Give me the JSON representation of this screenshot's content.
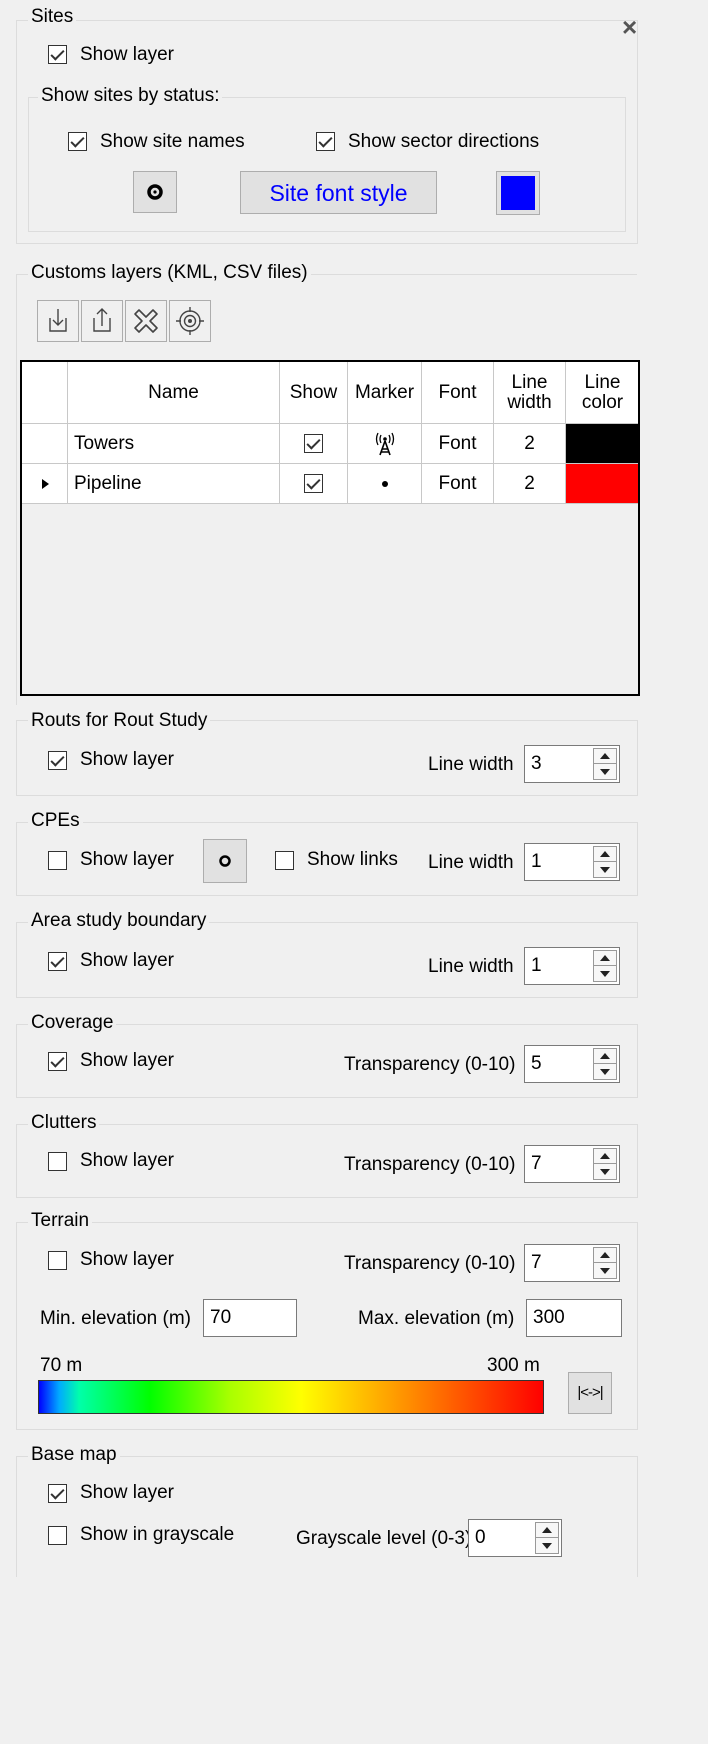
{
  "close_glyph": "×",
  "sites": {
    "title": "Sites",
    "show_layer": {
      "label": "Show layer",
      "checked": true
    },
    "status_group_title": "Show sites by status:",
    "show_site_names": {
      "label": "Show site names",
      "checked": true
    },
    "show_sector_directions": {
      "label": "Show sector directions",
      "checked": true
    },
    "font_style_button": "Site font style",
    "color": "#0000ff"
  },
  "custom_layers": {
    "title": "Customs layers (KML, CSV files)",
    "toolbar": [
      "import-icon",
      "export-icon",
      "remove-icon",
      "target-icon"
    ],
    "columns": [
      "Name",
      "Show",
      "Marker",
      "Font",
      "Line width",
      "Line color"
    ],
    "column_lines": {
      "line_width": [
        "Line",
        "width"
      ],
      "line_color": [
        "Line",
        "color"
      ]
    },
    "rows": [
      {
        "name": "Towers",
        "show": true,
        "marker": "tower-icon",
        "font": "Font",
        "line_width": "2",
        "line_color": "#000000",
        "current": false
      },
      {
        "name": "Pipeline",
        "show": true,
        "marker": "dot-icon",
        "font": "Font",
        "line_width": "2",
        "line_color": "#ff0000",
        "current": true
      }
    ]
  },
  "routes": {
    "title": "Routs for Rout Study",
    "show_layer": {
      "label": "Show layer",
      "checked": true
    },
    "line_width_label": "Line width",
    "line_width": "3"
  },
  "cpes": {
    "title": "CPEs",
    "show_layer": {
      "label": "Show layer",
      "checked": false
    },
    "show_links": {
      "label": "Show links",
      "checked": false
    },
    "line_width_label": "Line width",
    "line_width": "1"
  },
  "area_study": {
    "title": "Area study boundary",
    "show_layer": {
      "label": "Show layer",
      "checked": true
    },
    "line_width_label": "Line width",
    "line_width": "1"
  },
  "coverage": {
    "title": "Coverage",
    "show_layer": {
      "label": "Show layer",
      "checked": true
    },
    "transparency_label": "Transparency (0-10)",
    "transparency": "5"
  },
  "clutters": {
    "title": "Clutters",
    "show_layer": {
      "label": "Show layer",
      "checked": false
    },
    "transparency_label": "Transparency (0-10)",
    "transparency": "7"
  },
  "terrain": {
    "title": "Terrain",
    "show_layer": {
      "label": "Show layer",
      "checked": false
    },
    "transparency_label": "Transparency (0-10)",
    "transparency": "7",
    "min_elev_label": "Min. elevation (m)",
    "min_elev": "70",
    "max_elev_label": "Max. elevation (m)",
    "max_elev": "300",
    "scale_min": "70 m",
    "scale_max": "300 m",
    "fit_button": "|<->|"
  },
  "base_map": {
    "title": "Base map",
    "show_layer": {
      "label": "Show layer",
      "checked": true
    },
    "grayscale": {
      "label": "Show in grayscale",
      "checked": false
    },
    "grayscale_level_label": "Grayscale level (0-3)",
    "grayscale_level": "0"
  }
}
